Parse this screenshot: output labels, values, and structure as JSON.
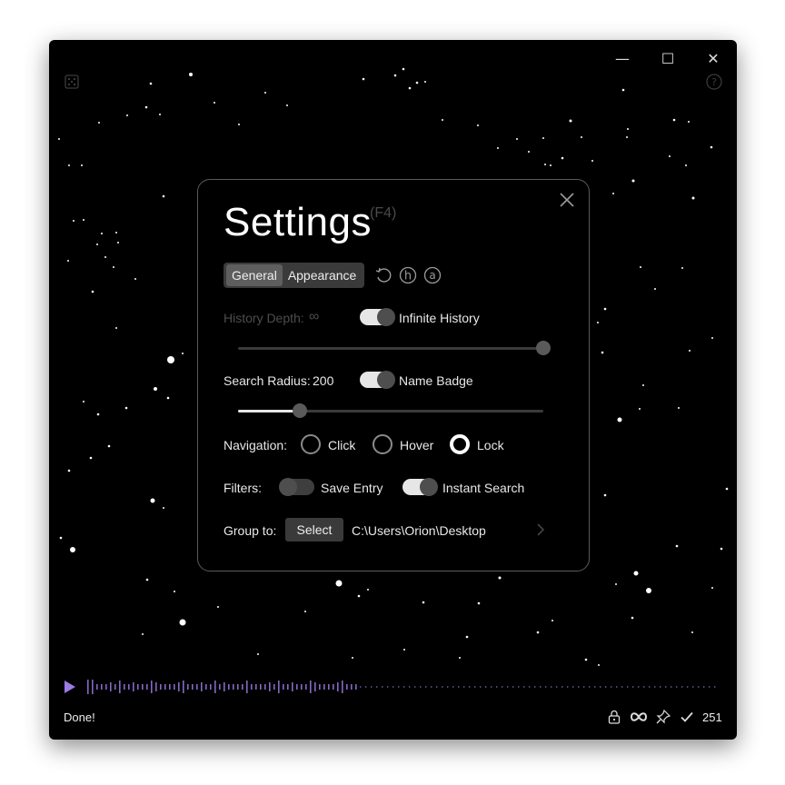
{
  "window": {
    "controls": {
      "minimize": "—",
      "maximize": "☐",
      "close": "✕"
    }
  },
  "settings": {
    "title": "Settings",
    "shortcut": "(F4)",
    "tabs": [
      {
        "label": "General",
        "active": true
      },
      {
        "label": "Appearance",
        "active": false
      }
    ],
    "tool_icons": [
      "reset-icon",
      "h-circle-icon",
      "a-circle-icon"
    ],
    "history": {
      "label": "History Depth:",
      "value": "∞",
      "toggle_label": "Infinite History",
      "toggle_on": true,
      "slider_fraction": 1.0
    },
    "search": {
      "label": "Search Radius:",
      "value": "200",
      "toggle_label": "Name Badge",
      "toggle_on": true,
      "slider_fraction": 0.2
    },
    "navigation": {
      "label": "Navigation:",
      "options": [
        {
          "label": "Click",
          "selected": false
        },
        {
          "label": "Hover",
          "selected": false
        },
        {
          "label": "Lock",
          "selected": true
        }
      ]
    },
    "filters": {
      "label": "Filters:",
      "items": [
        {
          "label": "Save Entry",
          "on": false
        },
        {
          "label": "Instant Search",
          "on": true
        }
      ]
    },
    "group": {
      "label": "Group to:",
      "button": "Select",
      "path": "C:\\Users\\Orion\\Desktop"
    }
  },
  "footer": {
    "status": "Done!",
    "count": "251",
    "icons": [
      "lock-icon",
      "infinity-icon",
      "pin-icon",
      "check-icon"
    ]
  },
  "colors": {
    "accent": "#9b7be6",
    "panel_border": "#5a5a5a",
    "toggle_on": "#e6e6e6"
  }
}
